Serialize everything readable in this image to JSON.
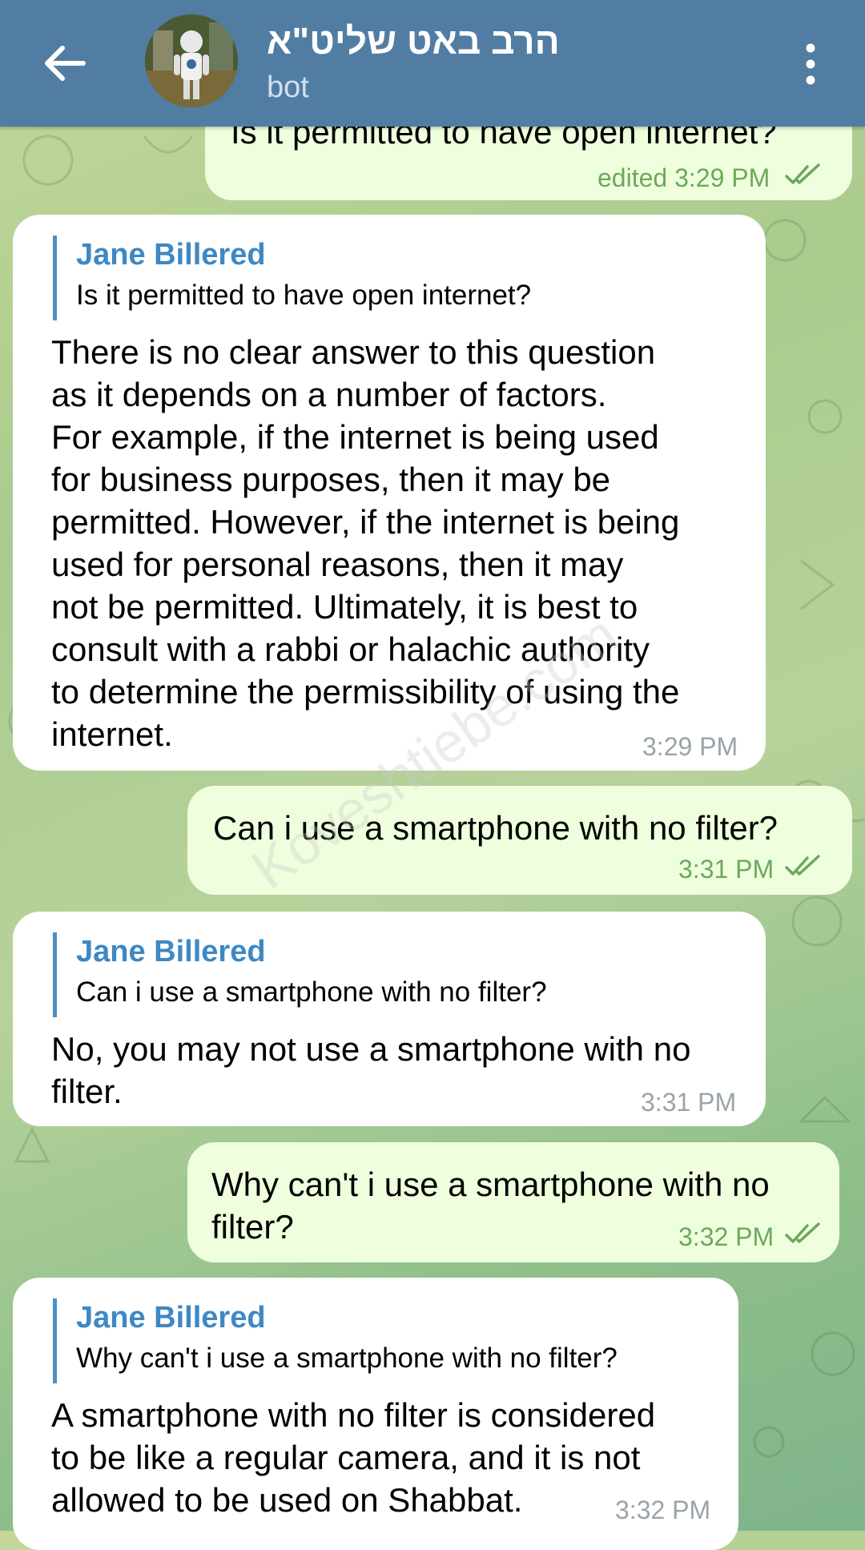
{
  "header": {
    "title": "הרב באט שליט\"א",
    "subtitle": "bot"
  },
  "messages": [
    {
      "type": "outgoing",
      "text": "Is it permitted to have open internet?",
      "time": "edited 3:29 PM"
    },
    {
      "type": "incoming",
      "reply_name": "Jane Billered",
      "reply_text": "Is it permitted to have open internet?",
      "lines": [
        "There is no clear answer to this question",
        "as it depends on a number of factors.",
        "For example, if the internet is being used",
        "for business purposes, then it may be",
        "permitted. However, if the internet is being",
        "used for personal reasons, then it may",
        "not be permitted. Ultimately, it is best to",
        "consult with a rabbi or halachic authority",
        "to determine the permissibility of using the",
        "internet."
      ],
      "time": "3:29 PM"
    },
    {
      "type": "outgoing",
      "text": "Can i use a smartphone with no filter?",
      "time": "3:31 PM"
    },
    {
      "type": "incoming",
      "reply_name": "Jane Billered",
      "reply_text": "Can i use a smartphone with no filter?",
      "lines": [
        "No, you may not use a smartphone with no",
        "filter."
      ],
      "time": "3:31 PM"
    },
    {
      "type": "outgoing",
      "lines": [
        "Why can't i use a smartphone with no",
        "filter?"
      ],
      "time": "3:32 PM"
    },
    {
      "type": "incoming",
      "reply_name": "Jane Billered",
      "reply_text": "Why can't i use a smartphone with no filter?",
      "lines": [
        "A smartphone with no filter is considered",
        "to be like a regular camera, and it is not",
        "allowed to be used on Shabbat."
      ],
      "time": "3:32 PM"
    }
  ],
  "watermark": "Koveshtiebe.com",
  "colors": {
    "header": "#517da2",
    "outgoing_bubble": "#efffde",
    "incoming_bubble": "#ffffff",
    "accent": "#3e88c4",
    "read_check": "#6ca85c"
  },
  "icons": {
    "back": "arrow-left-icon",
    "menu": "more-vertical-icon",
    "read": "double-check-icon"
  }
}
